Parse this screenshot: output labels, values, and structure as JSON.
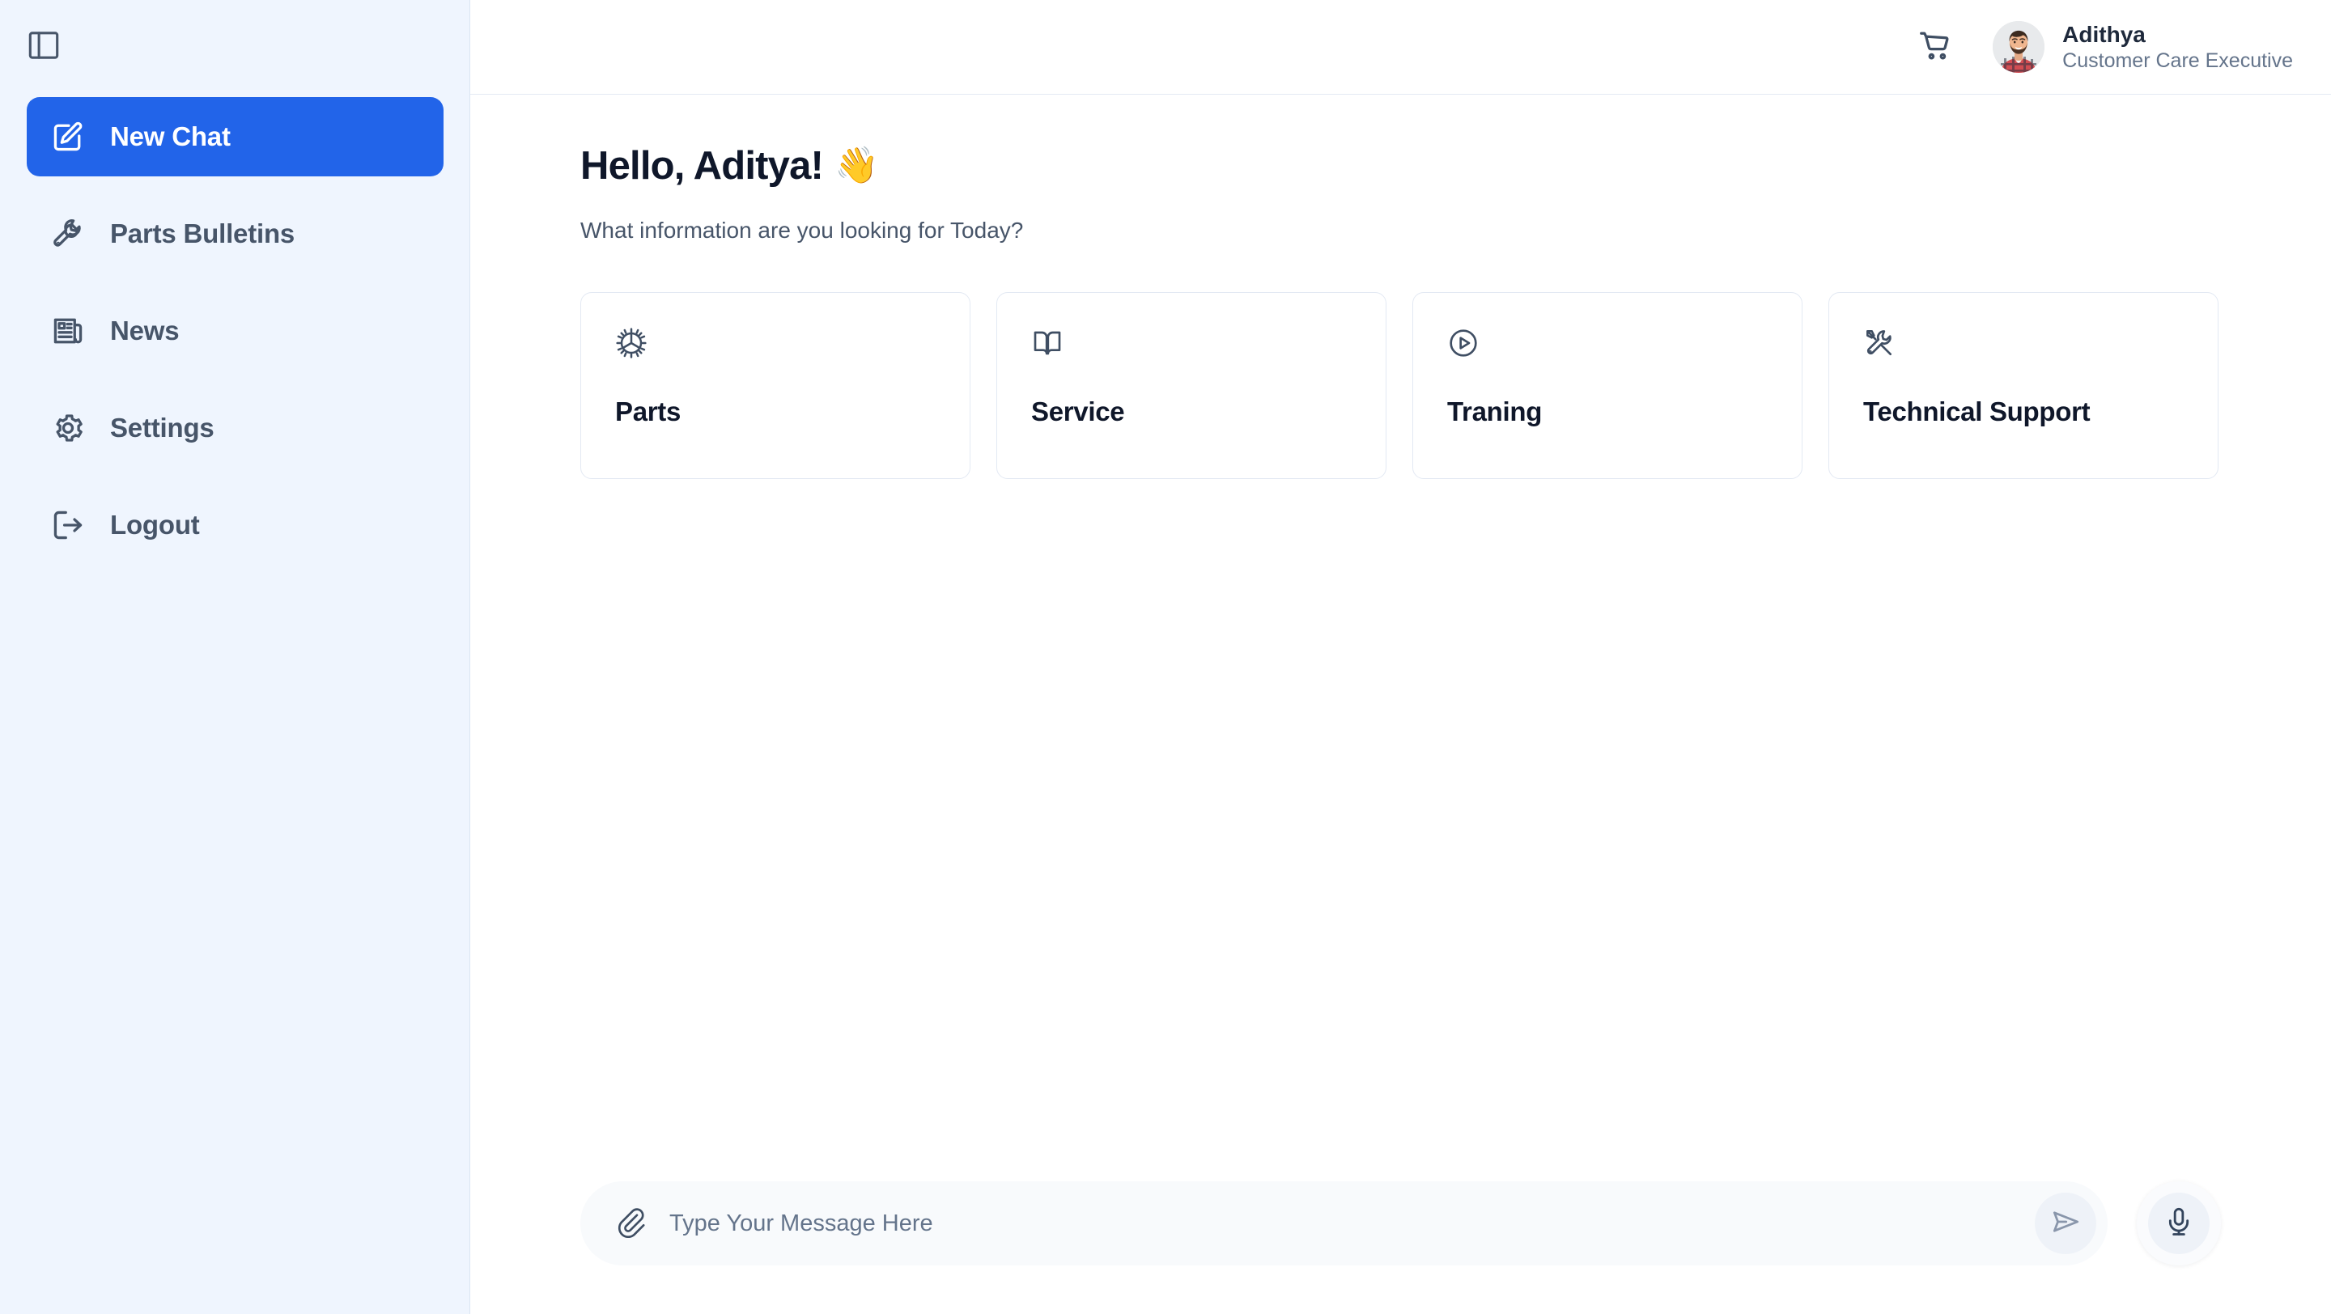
{
  "sidebar": {
    "toggle_icon": "panel-left-icon",
    "items": [
      {
        "label": "New Chat",
        "icon": "pencil-square-icon",
        "active": true
      },
      {
        "label": "Parts Bulletins",
        "icon": "wrench-icon",
        "active": false
      },
      {
        "label": "News",
        "icon": "newspaper-icon",
        "active": false
      },
      {
        "label": "Settings",
        "icon": "gear-icon",
        "active": false
      },
      {
        "label": "Logout",
        "icon": "logout-icon",
        "active": false
      }
    ],
    "background": "#eff5fe",
    "active_color": "#2264e9"
  },
  "topbar": {
    "cart_icon": "shopping-cart-icon",
    "user": {
      "name": "Adithya",
      "role": "Customer Care Executive",
      "avatar": "user-photo-avatar"
    }
  },
  "main": {
    "greeting": "Hello, Aditya!",
    "greeting_emoji": "👋",
    "subtitle": "What information are you looking for Today?",
    "cards": [
      {
        "title": "Parts",
        "icon": "cog-icon"
      },
      {
        "title": "Service",
        "icon": "open-book-icon"
      },
      {
        "title": "Traning",
        "icon": "play-circle-icon"
      },
      {
        "title": "Technical Support",
        "icon": "tools-icon"
      }
    ]
  },
  "composer": {
    "attach_icon": "paperclip-icon",
    "input_value": "",
    "input_placeholder": "Type Your Message Here",
    "send_icon": "send-icon",
    "mic_icon": "microphone-icon"
  }
}
